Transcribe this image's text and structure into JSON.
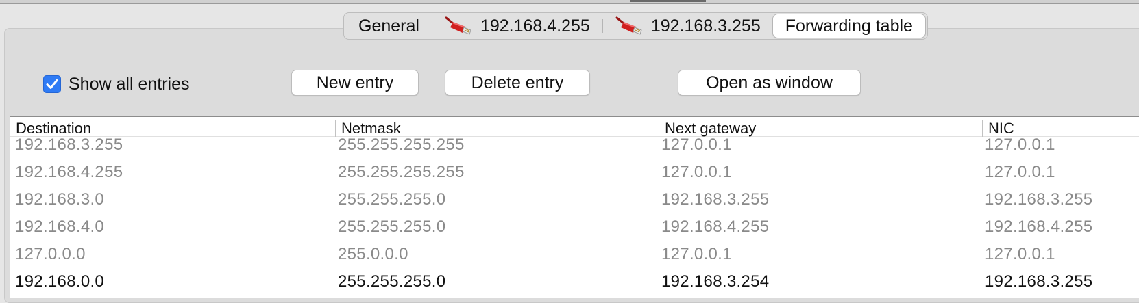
{
  "tabs": [
    {
      "label": "General",
      "icon": "none",
      "selected": false
    },
    {
      "label": "192.168.4.255",
      "icon": "network-cable-icon",
      "selected": false
    },
    {
      "label": "192.168.3.255",
      "icon": "network-cable-icon",
      "selected": false
    },
    {
      "label": "Forwarding table",
      "icon": "none",
      "selected": true
    }
  ],
  "controls": {
    "show_all_label": "Show all entries",
    "show_all_checked": true,
    "new_entry_label": "New entry",
    "delete_entry_label": "Delete entry",
    "open_window_label": "Open as window"
  },
  "table": {
    "columns": [
      "Destination",
      "Netmask",
      "Next gateway",
      "NIC"
    ],
    "rows": [
      {
        "destination": "192.168.3.255",
        "netmask": "255.255.255.255",
        "gateway": "127.0.0.1",
        "nic": "127.0.0.1",
        "active": false
      },
      {
        "destination": "192.168.4.255",
        "netmask": "255.255.255.255",
        "gateway": "127.0.0.1",
        "nic": "127.0.0.1",
        "active": false
      },
      {
        "destination": "192.168.3.0",
        "netmask": "255.255.255.0",
        "gateway": "192.168.3.255",
        "nic": "192.168.3.255",
        "active": false
      },
      {
        "destination": "192.168.4.0",
        "netmask": "255.255.255.0",
        "gateway": "192.168.4.255",
        "nic": "192.168.4.255",
        "active": false
      },
      {
        "destination": "127.0.0.0",
        "netmask": "255.0.0.0",
        "gateway": "127.0.0.1",
        "nic": "127.0.0.1",
        "active": false
      },
      {
        "destination": "192.168.0.0",
        "netmask": "255.255.255.0",
        "gateway": "192.168.3.254",
        "nic": "192.168.3.255",
        "active": true
      }
    ]
  },
  "colors": {
    "accent": "#2f7bf5",
    "inactive_text": "#8a8a8a",
    "active_text": "#111111",
    "cable_red": "#d01f1f"
  }
}
